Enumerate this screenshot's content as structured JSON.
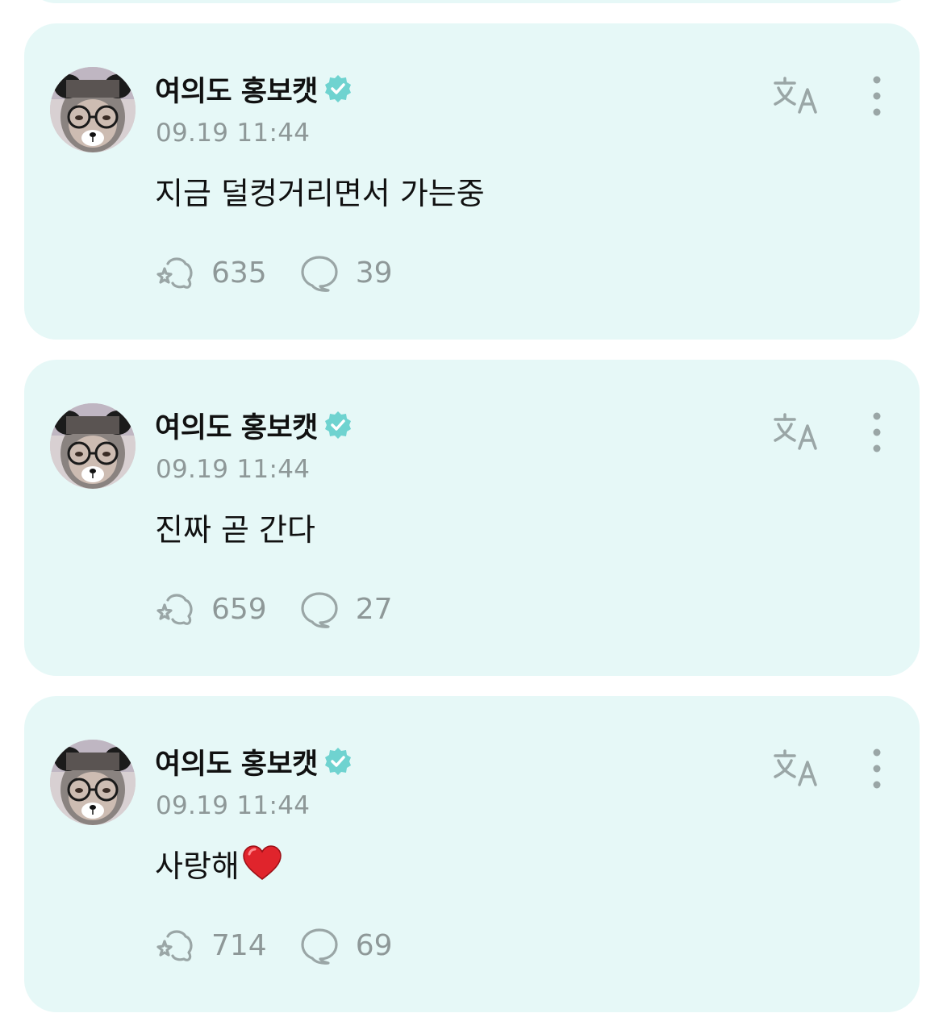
{
  "colors": {
    "card_background": "#e6f8f7",
    "accent": "#6fd3d0",
    "text_primary": "#111111",
    "text_secondary": "#8e9898"
  },
  "icons": {
    "verified": "verified-badge-icon",
    "translate": "translate-icon",
    "more": "more-vertical-icon",
    "like": "sparkle-heart-icon",
    "comment": "comment-bubble-icon",
    "emoji": "red-heart-emoji-icon"
  },
  "posts": [
    {
      "author": "여의도 홍보캣",
      "time": "09.19 11:44",
      "text": "지금 덜컹거리면서 가는중",
      "likes": "635",
      "comments": "39"
    },
    {
      "author": "여의도 홍보캣",
      "time": "09.19 11:44",
      "text": "진짜 곧 간다",
      "likes": "659",
      "comments": "27"
    },
    {
      "author": "여의도 홍보캣",
      "time": "09.19 11:44",
      "text": "사랑해",
      "likes": "714",
      "comments": "69"
    }
  ]
}
